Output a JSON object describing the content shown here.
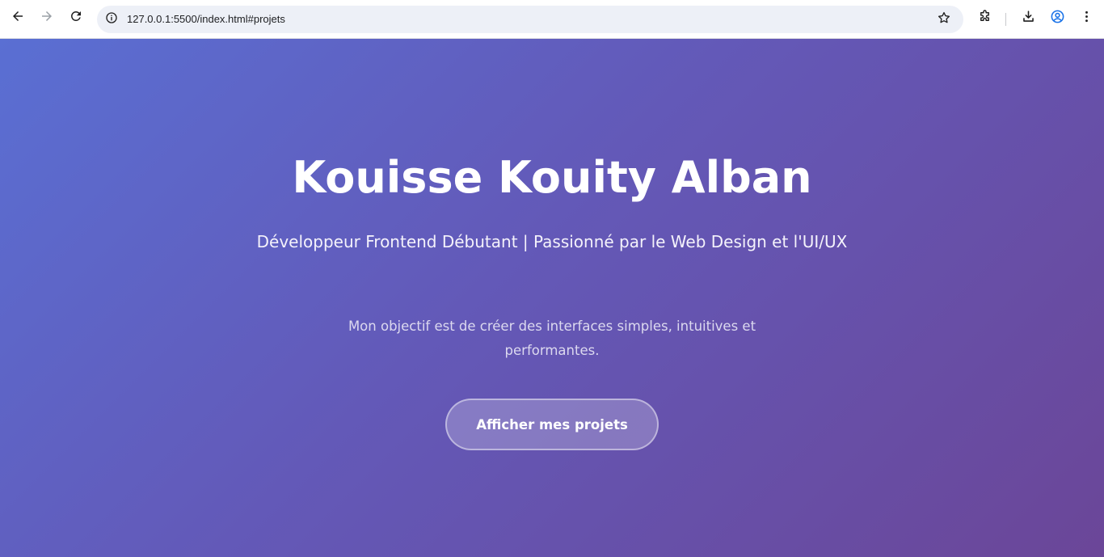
{
  "browser": {
    "url": "127.0.0.1:5500/index.html#projets",
    "icons": {
      "back": "arrow-left-icon",
      "forward": "arrow-right-icon",
      "reload": "reload-icon",
      "site_info": "info-icon",
      "bookmark": "star-icon",
      "extensions": "puzzle-icon",
      "downloads": "download-icon",
      "profile": "account-icon",
      "menu": "kebab-menu-icon"
    },
    "accent": "#1a73e8"
  },
  "hero": {
    "title": "Kouisse Kouity Alban",
    "subtitle": "Développeur Frontend Débutant | Passionné par le Web Design et l'UI/UX",
    "text": "Mon objectif est de créer des interfaces simples, intuitives et performantes.",
    "cta_label": "Afficher mes projets",
    "gradient": [
      "#5a6fd3",
      "#6b4698"
    ]
  }
}
